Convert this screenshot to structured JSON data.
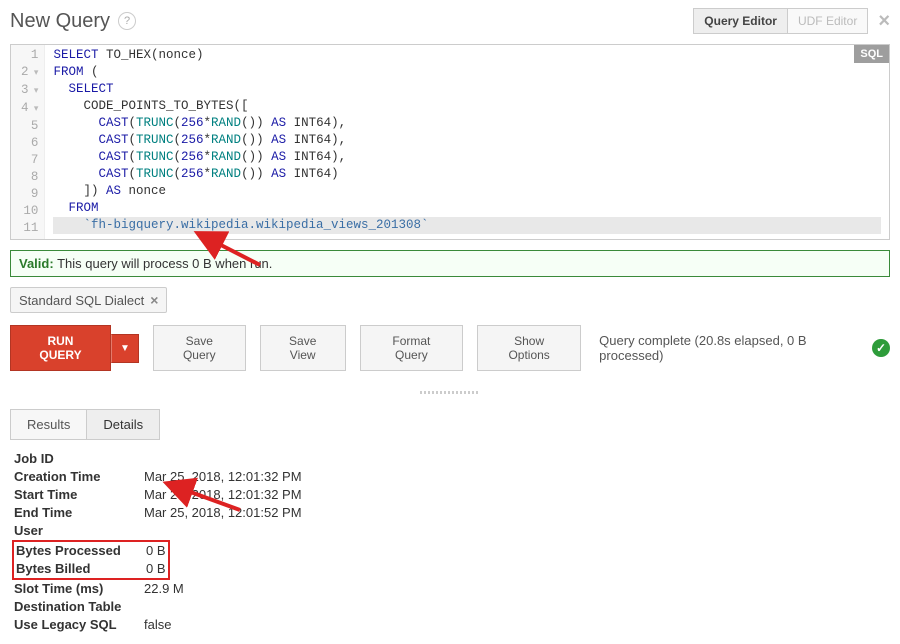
{
  "header": {
    "title": "New Query",
    "query_editor_btn": "Query Editor",
    "udf_editor_btn": "UDF Editor",
    "sql_badge": "SQL"
  },
  "code_lines": [
    "SELECT TO_HEX(nonce)",
    "FROM (",
    "  SELECT",
    "    CODE_POINTS_TO_BYTES([",
    "      CAST(TRUNC(256*RAND()) AS INT64),",
    "      CAST(TRUNC(256*RAND()) AS INT64),",
    "      CAST(TRUNC(256*RAND()) AS INT64),",
    "      CAST(TRUNC(256*RAND()) AS INT64)",
    "    ]) AS nonce",
    "  FROM",
    "    `fh-bigquery.wikipedia.wikipedia_views_201308`"
  ],
  "valid": {
    "label": "Valid:",
    "message": "This query will process 0 B when run."
  },
  "chip": {
    "label": "Standard SQL Dialect"
  },
  "toolbar": {
    "run": "RUN QUERY",
    "save_query": "Save Query",
    "save_view": "Save View",
    "format": "Format Query",
    "show_options": "Show Options",
    "status": "Query complete (20.8s elapsed, 0 B processed)"
  },
  "tabs": {
    "results": "Results",
    "details": "Details"
  },
  "details": {
    "job_id": {
      "label": "Job ID",
      "value": ""
    },
    "creation_time": {
      "label": "Creation Time",
      "value": "Mar 25, 2018, 12:01:32 PM"
    },
    "start_time": {
      "label": "Start Time",
      "value": "Mar 25, 2018, 12:01:32 PM"
    },
    "end_time": {
      "label": "End Time",
      "value": "Mar 25, 2018, 12:01:52 PM"
    },
    "user": {
      "label": "User",
      "value": ""
    },
    "bytes_processed": {
      "label": "Bytes Processed",
      "value": "0 B"
    },
    "bytes_billed": {
      "label": "Bytes Billed",
      "value": "0 B"
    },
    "slot_time": {
      "label": "Slot Time (ms)",
      "value": "22.9 M"
    },
    "destination_table": {
      "label": "Destination Table",
      "value": ""
    },
    "use_legacy_sql": {
      "label": "Use Legacy SQL",
      "value": "false"
    }
  }
}
